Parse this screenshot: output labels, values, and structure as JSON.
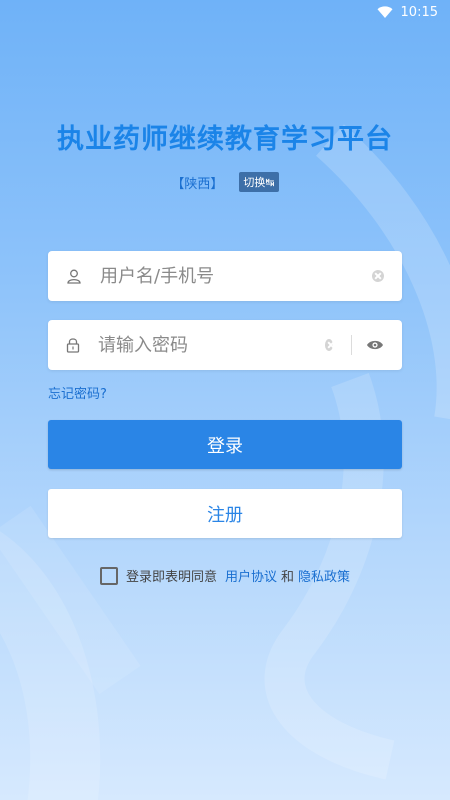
{
  "status_bar": {
    "time": "10:15"
  },
  "title": "执业药师继续教育学习平台",
  "region": {
    "label": "【陕西】",
    "switch_label": "切换↹"
  },
  "username": {
    "placeholder": "用户名/手机号"
  },
  "password": {
    "placeholder": "请输入密码"
  },
  "forgot_label": "忘记密码?",
  "login_label": "登录",
  "register_label": "注册",
  "agreement": {
    "prefix": "登录即表明同意",
    "user_agreement": "用户协议",
    "and": "和",
    "privacy_policy": "隐私政策"
  },
  "colors": {
    "accent": "#2a85e6",
    "title": "#1b84e8",
    "link": "#1a6fd0"
  }
}
